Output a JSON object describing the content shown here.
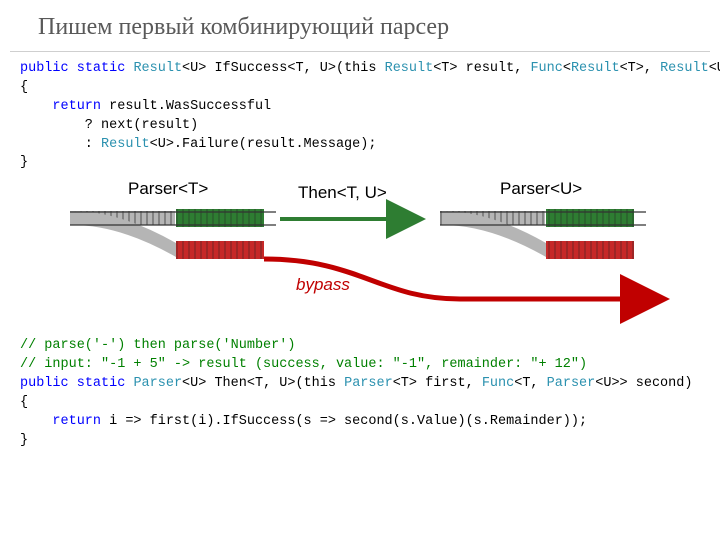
{
  "title": "Пишем первый комбинирующий парсер",
  "code1": {
    "sig": {
      "kw_public": "public",
      "kw_static": "static",
      "t_result": "Result",
      "m_name": "IfSuccess",
      "gen": "<T, U>",
      "params_a": "(this ",
      "t_result2": "Result",
      "gen_t": "<T>",
      "params_b": " result, ",
      "t_func": "Func",
      "func_gen_a": "<",
      "t_result3": "Result",
      "func_gen_b": "<T>, ",
      "t_result4": "Result",
      "func_gen_c": "<U>> next)"
    },
    "l_open": "{",
    "l_ret": {
      "kw_return": "return",
      "rest": " result.WasSuccessful"
    },
    "l_q": "        ? next(result)",
    "l_c": {
      "a": "        : ",
      "t_result": "Result",
      "b": "<U>.Failure(result.Message);"
    },
    "l_close": "}"
  },
  "diagram": {
    "label_left": "Parser<T>",
    "label_mid": "Then<T, U>",
    "label_right": "Parser<U>",
    "bypass": "bypass"
  },
  "code2": {
    "c1": "// parse('-') then parse('Number')",
    "c2": "// input: \"-1 + 5\" -> result (success, value: \"-1\", remainder: \"+ 12\")",
    "sig": {
      "kw_public": "public",
      "kw_static": "static",
      "t_parser": "Parser",
      "gen_u": "<U>",
      "m_name": " Then",
      "gen_tu": "<T, U>",
      "p_a": "(this ",
      "t_parser2": "Parser",
      "p_b": "<T> first, ",
      "t_func": "Func",
      "p_c": "<T, ",
      "t_parser3": "Parser",
      "p_d": "<U>> second)"
    },
    "l_open": "{",
    "l_ret": {
      "kw_return": "return",
      "rest": " i => first(i).IfSuccess(s => second(s.Value)(s.Remainder));"
    },
    "l_close": "}"
  }
}
